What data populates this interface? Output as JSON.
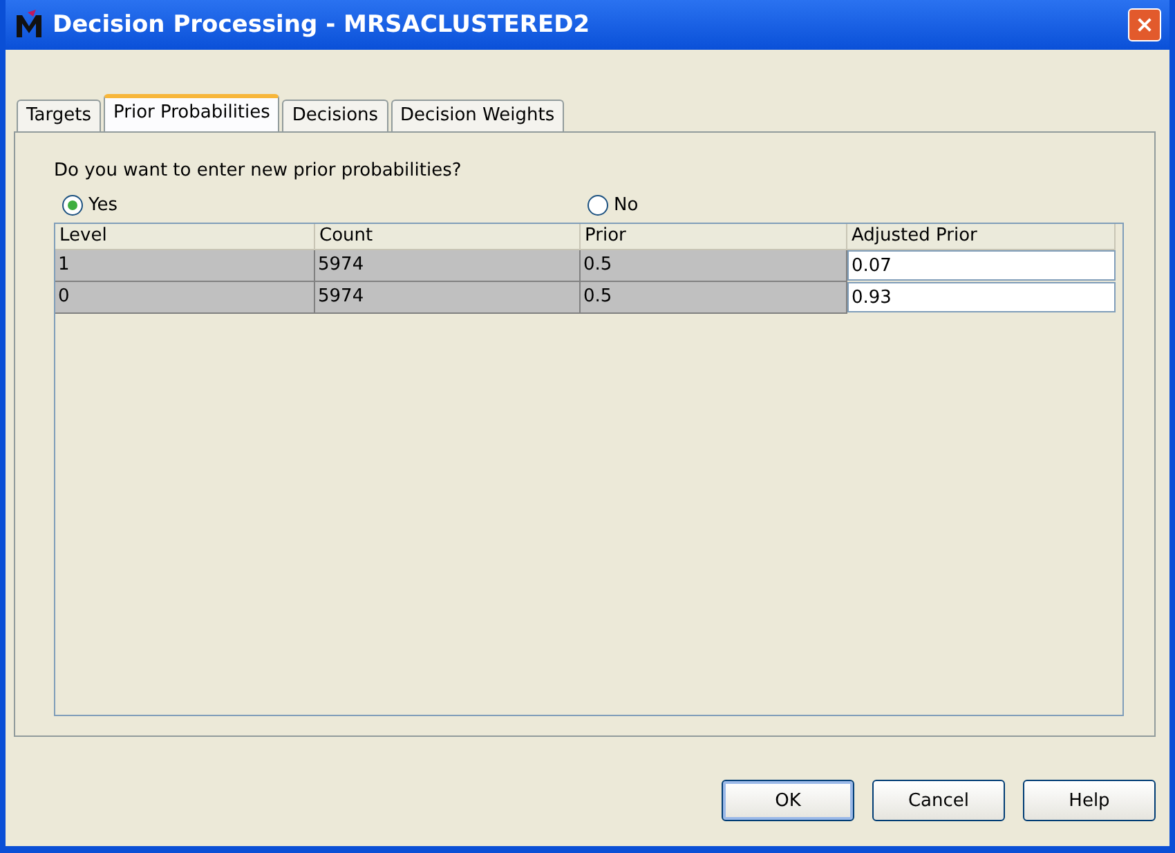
{
  "window": {
    "title": "Decision Processing - MRSACLUSTERED2"
  },
  "tabs": [
    {
      "label": "Targets",
      "selected": false
    },
    {
      "label": "Prior Probabilities",
      "selected": true
    },
    {
      "label": "Decisions",
      "selected": false
    },
    {
      "label": "Decision Weights",
      "selected": false
    }
  ],
  "question": "Do you want to enter new prior probabilities?",
  "options": [
    {
      "label": "Yes",
      "selected": true
    },
    {
      "label": "No",
      "selected": false
    }
  ],
  "table": {
    "columns": [
      "Level",
      "Count",
      "Prior",
      "Adjusted Prior"
    ],
    "rows": [
      [
        "1",
        "5974",
        "0.5",
        "0.07"
      ],
      [
        "0",
        "5974",
        "0.5",
        "0.93"
      ]
    ]
  },
  "buttons": [
    {
      "label": "OK",
      "default": true
    },
    {
      "label": "Cancel",
      "default": false
    },
    {
      "label": "Help",
      "default": false
    }
  ]
}
